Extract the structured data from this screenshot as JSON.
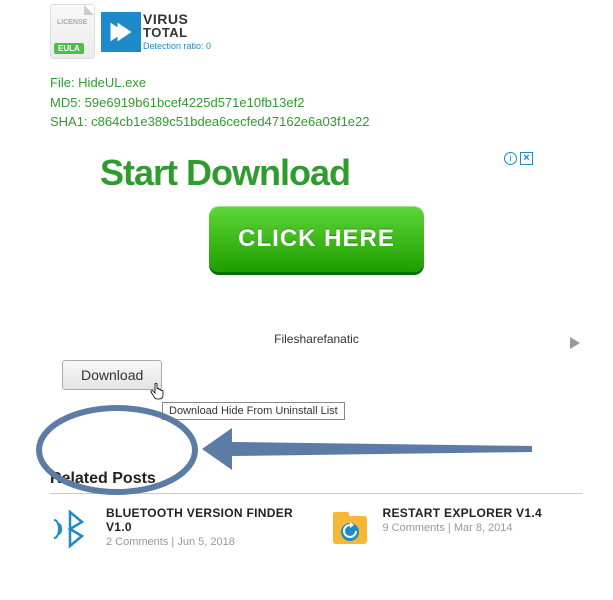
{
  "badges": {
    "license_small": "LICENSE",
    "eula": "EULA",
    "vt_line1": "VIRUS",
    "vt_line2": "TOTAL",
    "detection": "Detection ratio:  0"
  },
  "file_info": {
    "file": "File: HideUL.exe",
    "md5": "MD5: 59e6919b61bcef4225d571e10fb13ef2",
    "sha1": "SHA1: c864cb1e389c51bdea6cecfed47162e6a03f1e22"
  },
  "ad": {
    "headline": "Start Download",
    "button": "CLICK HERE",
    "close_info": "i",
    "close_x": "×"
  },
  "sponsor": "Filesharefanatic",
  "download": {
    "label": "Download",
    "tooltip": "Download Hide From Uninstall List"
  },
  "related": {
    "heading": "Related Posts",
    "posts": [
      {
        "title": "BLUETOOTH VERSION FINDER V1.0",
        "meta": "2 Comments | Jun 5, 2018"
      },
      {
        "title": "RESTART EXPLORER V1.4",
        "meta": "9 Comments | Mar 8, 2014"
      }
    ]
  }
}
